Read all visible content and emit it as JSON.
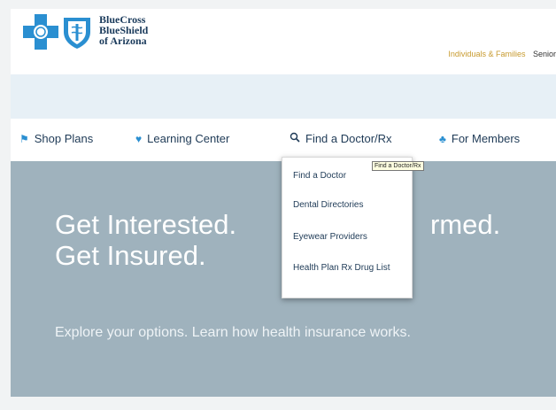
{
  "brand": {
    "line1": "BlueCross",
    "line2": "BlueShield",
    "line3": "of Arizona",
    "color": "#1b3b5c",
    "accent": "#2a8fd1"
  },
  "top_links": {
    "individuals": "Individuals & Families",
    "seniors": "Senior"
  },
  "nav": {
    "items": [
      {
        "label": "Shop Plans",
        "icon": "shop-icon"
      },
      {
        "label": "Learning Center",
        "icon": "heart-icon"
      },
      {
        "label": "Find a Doctor/Rx",
        "icon": "search-icon"
      },
      {
        "label": "For Members",
        "icon": "members-icon"
      }
    ]
  },
  "dropdown": {
    "items": [
      {
        "label": "Find a Doctor"
      },
      {
        "label": "Dental Directories"
      },
      {
        "label": "Eyewear Providers"
      },
      {
        "label": "Health Plan Rx Drug List"
      }
    ],
    "tooltip": "Find a Doctor/Rx"
  },
  "hero": {
    "line1": "Get Interested.",
    "line1_right": "rmed.",
    "line2": "Get Insured.",
    "subtitle": "Explore your options. Learn how health insurance works.",
    "background": "#9fb2bd"
  }
}
